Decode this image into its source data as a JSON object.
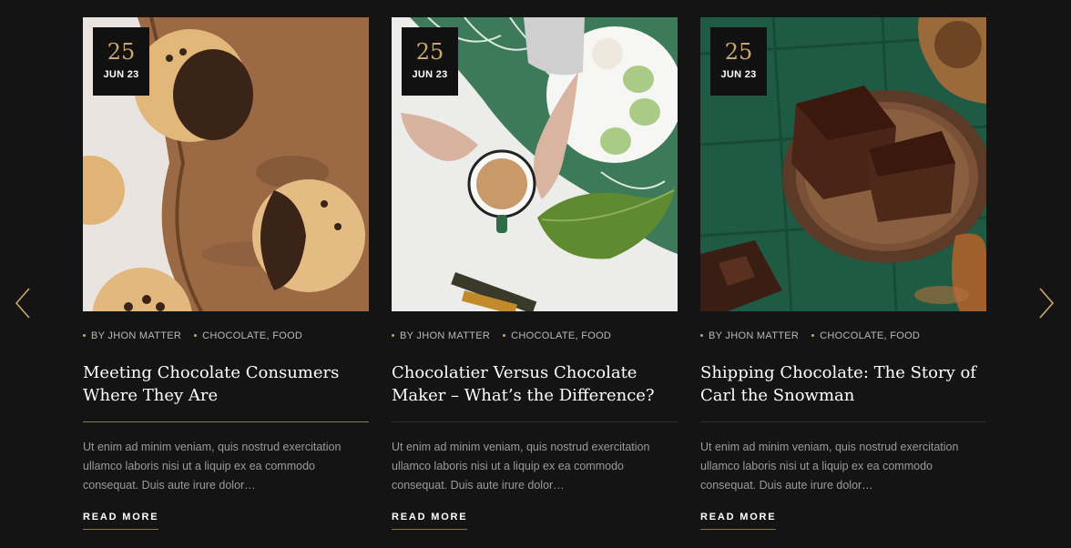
{
  "posts": [
    {
      "day": "25",
      "month": "JUN 23",
      "author": "BY JHON MATTER",
      "categories": "CHOCOLATE, FOOD",
      "title_line1": "Meeting Chocolate Consumers",
      "title_line2": "Where They Are",
      "excerpt": "Ut enim ad minim veniam, quis nostrud exercitation ullamco laboris nisi ut a liquip ex ea commodo consequat. Duis aute irure dolor…",
      "read_more": "READ MORE",
      "image": "muffins-on-wooden-board"
    },
    {
      "day": "25",
      "month": "JUN 23",
      "author": "BY JHON MATTER",
      "categories": "CHOCOLATE, FOOD",
      "title_line1": "Chocolatier Versus Chocolate",
      "title_line2": "Maker – What’s the Difference?",
      "excerpt": "Ut enim ad minim veniam, quis nostrud exercitation ullamco laboris nisi ut a liquip ex ea commodo consequat. Duis aute irure dolor…",
      "read_more": "READ MORE",
      "image": "coffee-cup-and-macarons"
    },
    {
      "day": "25",
      "month": "JUN 23",
      "author": "BY JHON MATTER",
      "categories": "CHOCOLATE, FOOD",
      "title_line1": "Shipping Chocolate: The Story of",
      "title_line2": "Carl the Snowman",
      "excerpt": "Ut enim ad minim veniam, quis nostrud exercitation ullamco laboris nisi ut a liquip ex ea commodo consequat. Duis aute irure dolor…",
      "read_more": "READ MORE",
      "image": "brownies-on-plate"
    }
  ],
  "icons": {
    "prev": "chevron-left-icon",
    "next": "chevron-right-icon"
  },
  "colors": {
    "background": "#141414",
    "accent_gold": "#c9a66b",
    "text_white": "#ffffff",
    "text_muted": "#9a9a9a"
  }
}
